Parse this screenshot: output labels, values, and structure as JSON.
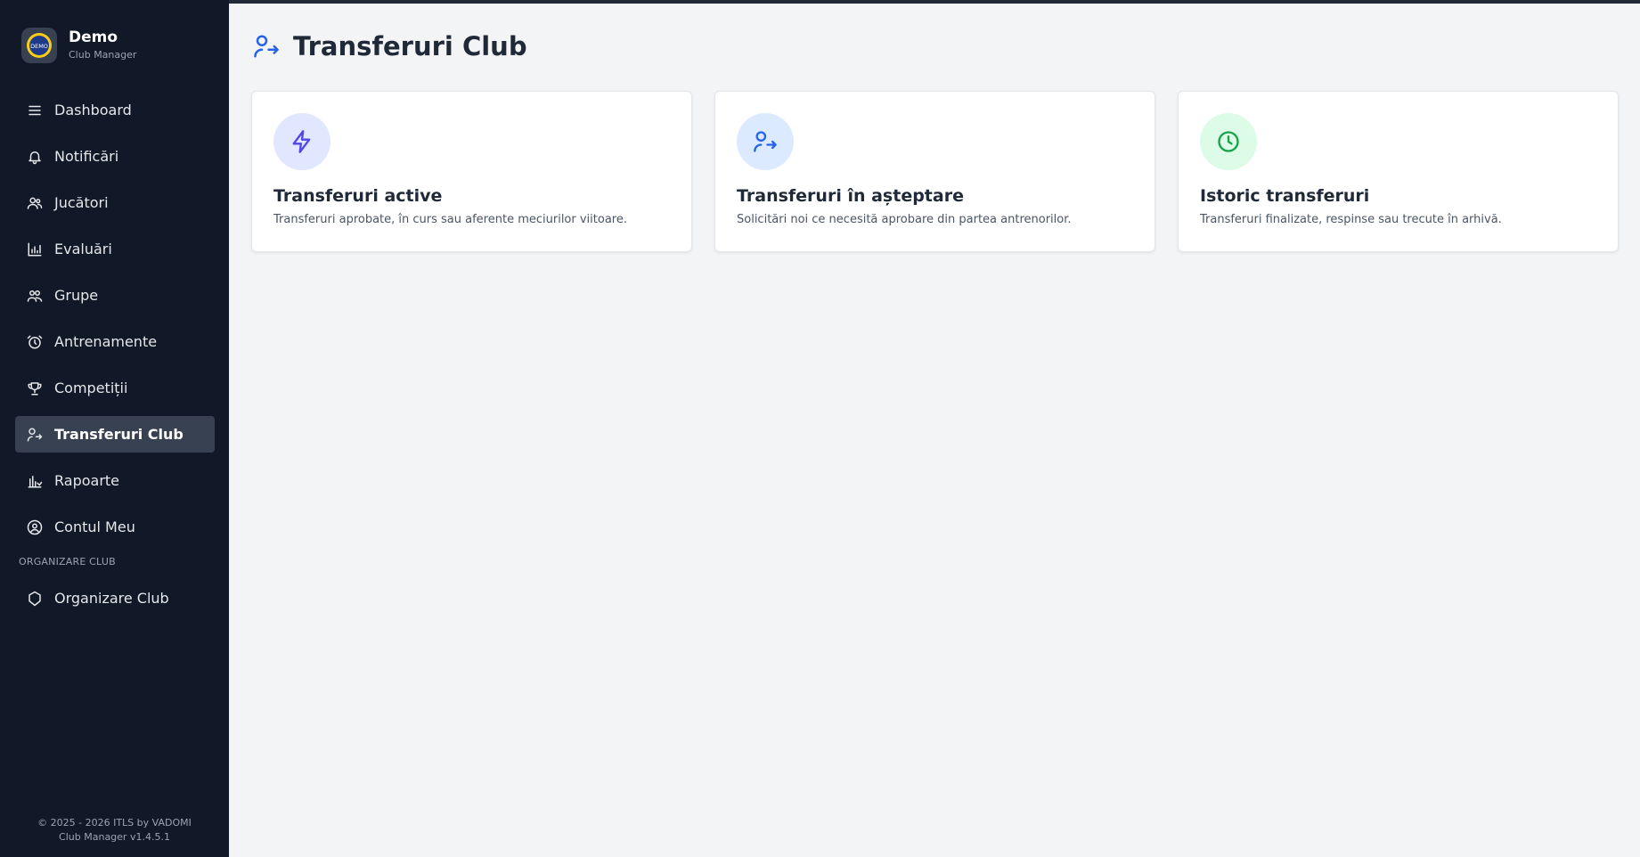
{
  "brand": {
    "title": "Demo",
    "subtitle": "Club Manager",
    "logo_text": "DEMO"
  },
  "sidebar": {
    "items": [
      {
        "label": "Dashboard",
        "icon": "menu-icon"
      },
      {
        "label": "Notificări",
        "icon": "bell-icon"
      },
      {
        "label": "Jucători",
        "icon": "users-icon"
      },
      {
        "label": "Evaluări",
        "icon": "bar-chart-icon"
      },
      {
        "label": "Grupe",
        "icon": "group-icon"
      },
      {
        "label": "Antrenamente",
        "icon": "alarm-clock-icon"
      },
      {
        "label": "Competiții",
        "icon": "trophy-icon"
      },
      {
        "label": "Transferuri Club",
        "icon": "user-transfer-icon",
        "active": true
      },
      {
        "label": "Rapoarte",
        "icon": "report-chart-icon"
      },
      {
        "label": "Contul Meu",
        "icon": "user-circle-icon"
      }
    ],
    "section_label": "ORGANIZARE CLUB",
    "section_items": [
      {
        "label": "Organizare Club",
        "icon": "shield-icon"
      }
    ]
  },
  "footer": {
    "line1": "© 2025 - 2026 ITLS by VADOMI",
    "line2": "Club Manager v1.4.5.1"
  },
  "page": {
    "title": "Transferuri Club"
  },
  "cards": [
    {
      "title": "Transferuri active",
      "description": "Transferuri aprobate, în curs sau aferente meciurilor viitoare.",
      "icon": "lightning-icon",
      "icon_bg": "#e0e7ff",
      "icon_color": "#4f46e5"
    },
    {
      "title": "Transferuri în așteptare",
      "description": "Solicitări noi ce necesită aprobare din partea antrenorilor.",
      "icon": "user-transfer-icon",
      "icon_bg": "#dbeafe",
      "icon_color": "#2563eb"
    },
    {
      "title": "Istoric transferuri",
      "description": "Transferuri finalizate, respinse sau trecute în arhivă.",
      "icon": "clock-icon",
      "icon_bg": "#dcfce7",
      "icon_color": "#16a34a"
    }
  ],
  "colors": {
    "sidebar_bg": "#111827",
    "active_bg": "#374151",
    "accent": "#2563eb",
    "page_bg": "#f3f4f6"
  }
}
